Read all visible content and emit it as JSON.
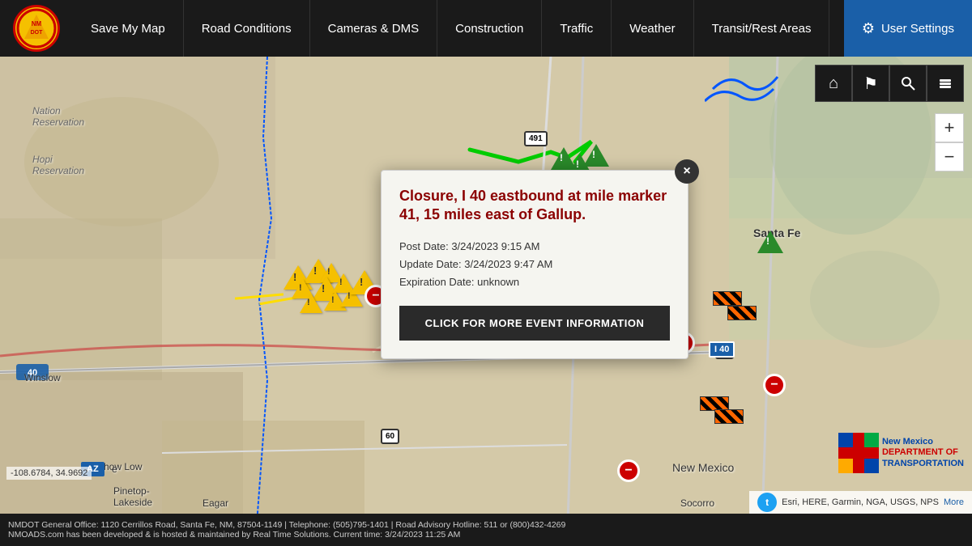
{
  "navbar": {
    "logo_text": "NMDOT",
    "links": [
      {
        "id": "save-map",
        "label": "Save My Map"
      },
      {
        "id": "road-conditions",
        "label": "Road Conditions"
      },
      {
        "id": "cameras-dms",
        "label": "Cameras & DMS"
      },
      {
        "id": "construction",
        "label": "Construction"
      },
      {
        "id": "traffic",
        "label": "Traffic"
      },
      {
        "id": "weather",
        "label": "Weather"
      },
      {
        "id": "transit",
        "label": "Transit/Rest Areas"
      }
    ],
    "settings_label": "User Settings"
  },
  "map_controls": [
    {
      "id": "home",
      "icon": "⌂",
      "active": false
    },
    {
      "id": "flag",
      "icon": "⚑",
      "active": false
    },
    {
      "id": "search",
      "icon": "🔍",
      "active": false
    },
    {
      "id": "layers",
      "icon": "⧉",
      "active": false
    }
  ],
  "popup": {
    "title": "Closure, I 40 eastbound at mile marker 41, 15 miles east of Gallup.",
    "post_date_label": "Post Date:",
    "post_date": "3/24/2023 9:15 AM",
    "update_date_label": "Update Date:",
    "update_date": "3/24/2023 9:47 AM",
    "expiration_label": "Expiration Date:",
    "expiration": "unknown",
    "button_label": "CLICK FOR MORE EVENT INFORMATION",
    "close_label": "×"
  },
  "map_labels": {
    "winslow": "Winslow",
    "show_low": "Show Low",
    "pinetop": "Pinetop-\nLakeside",
    "eagar": "Eagar",
    "santa_fe": "Santa Fe",
    "new_mexico": "New Mexico",
    "socorro": "Socorro"
  },
  "coords": "-108.6784, 34.9692",
  "footer": {
    "line1": "NMDOT General Office: 1120 Cerrillos Road, Santa Fe, NM, 87504-1149  |  Telephone: (505)795-1401  |  Road Advisory Hotline: 511 or (800)432-4269",
    "line2": "NMOADS.com has been developed & is hosted & maintained by Real Time Solutions. Current time: 3/24/2023 11:25 AM"
  },
  "attribution": {
    "text": "Esri, HERE, Garmin, NGA, USGS, NPS",
    "more": "More"
  },
  "zoom": {
    "plus": "+",
    "minus": "−"
  }
}
